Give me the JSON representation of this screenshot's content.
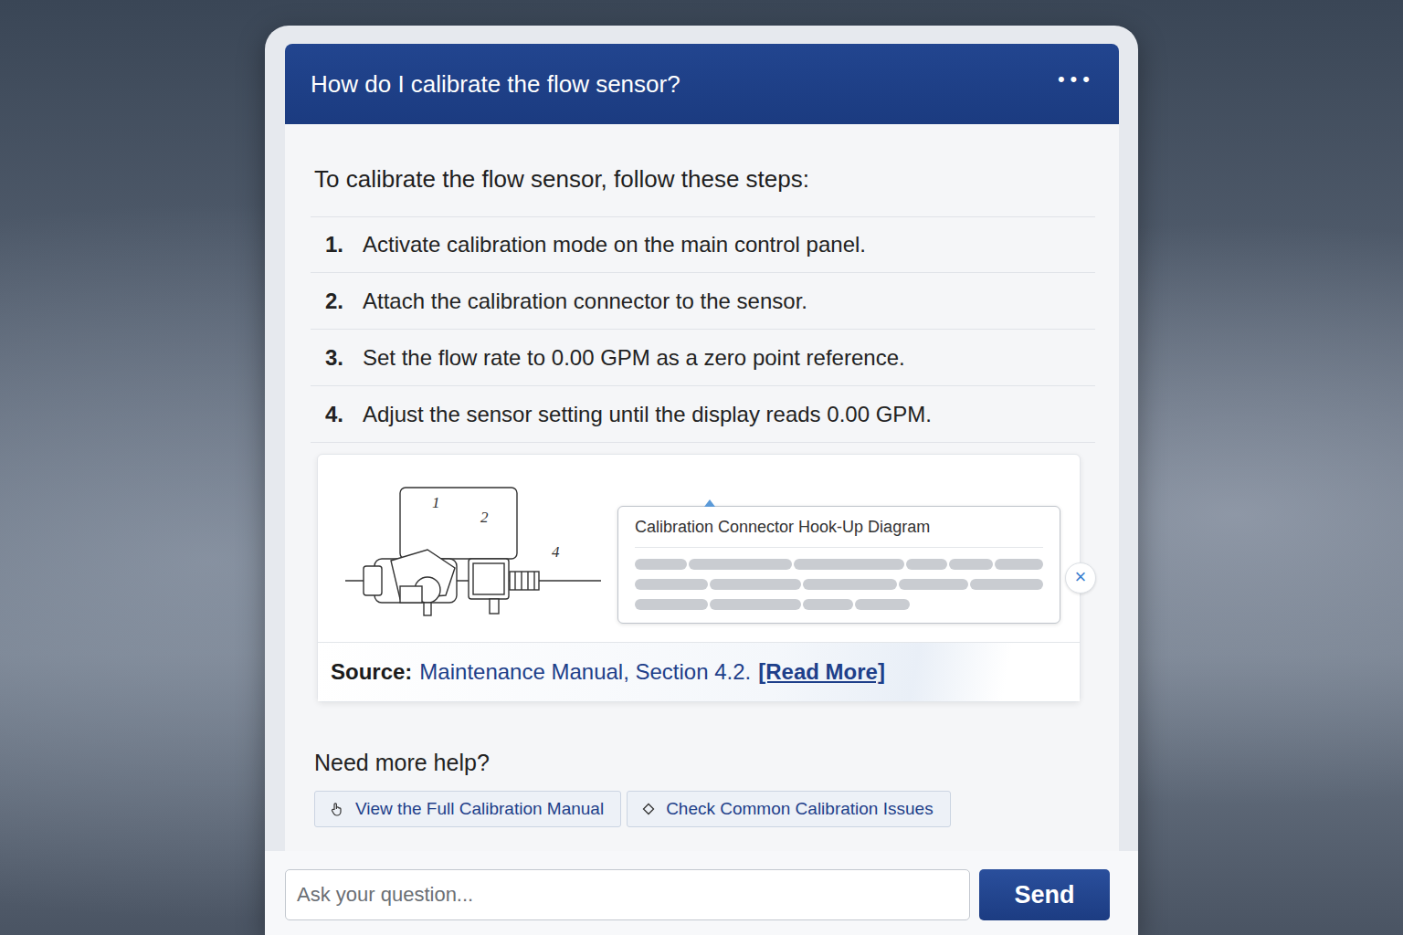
{
  "chat": {
    "question": "How do I calibrate the flow sensor?",
    "menu": "•••"
  },
  "answer": {
    "intro": "To calibrate the flow sensor, follow these steps:",
    "steps": [
      {
        "number": "1.",
        "text": "Activate calibration mode on the main control panel."
      },
      {
        "number": "2.",
        "text": "Attach the calibration connector to the sensor."
      },
      {
        "number": "3.",
        "text": "Set the flow rate to 0.00 GPM as a zero point reference."
      },
      {
        "number": "4.",
        "text": "Adjust the sensor setting until the display reads 0.00 GPM."
      }
    ]
  },
  "diagram": {
    "labels": [
      "1",
      "2",
      "4"
    ],
    "tooltip_title": "Calibration Connector Hook-Up Diagram",
    "close": "×"
  },
  "source": {
    "label": "Source:",
    "text": "Maintenance Manual, Section 4.2.",
    "link": "[Read More]"
  },
  "help": {
    "title": "Need more help?",
    "buttons": [
      {
        "label": "View the Full Calibration Manual"
      },
      {
        "label": "Check Common Calibration Issues"
      }
    ]
  },
  "composer": {
    "placeholder": "Ask your question...",
    "send": "Send"
  }
}
